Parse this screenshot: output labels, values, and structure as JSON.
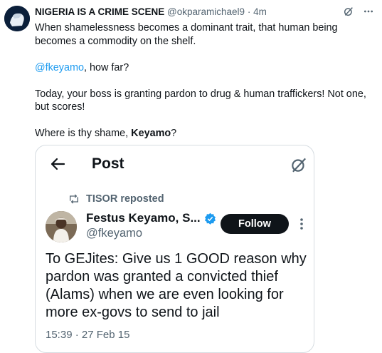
{
  "tweet": {
    "author_name": "NIGERIA IS A CRIME SCENE",
    "author_handle": "@okparamichael9",
    "separator": "·",
    "time": "4m",
    "line1": "When shamelessness becomes a dominant trait, that human being becomes a commodity on the shelf.",
    "mention": "@fkeyamo",
    "mention_suffix": ", how far?",
    "line3": "Today, your boss is granting pardon to drug & human traffickers! Not one, but scores!",
    "line4_prefix": "Where is thy shame, ",
    "line4_bold": "Keyamo",
    "line4_suffix": "?"
  },
  "embed": {
    "title": "Post",
    "reposted_by": "TISOR reposted",
    "quoted_name": "Festus Keyamo, S...",
    "quoted_handle": "@fkeyamo",
    "follow_label": "Follow",
    "quoted_text": "To GEJites: Give us 1 GOOD reason why pardon was granted a convicted thief (Alams) when we are even looking for more ex-govs to send to jail",
    "timestamp": "15:39 · 27 Feb 15"
  },
  "icons": {
    "grok": "grok-icon",
    "more": "more-icon",
    "back": "back-arrow-icon",
    "repost": "repost-icon",
    "verified": "verified-badge-icon"
  },
  "colors": {
    "link": "#1d9bf0",
    "secondary": "#536471",
    "verified": "#1d9bf0",
    "follow_bg": "#0f1419"
  }
}
